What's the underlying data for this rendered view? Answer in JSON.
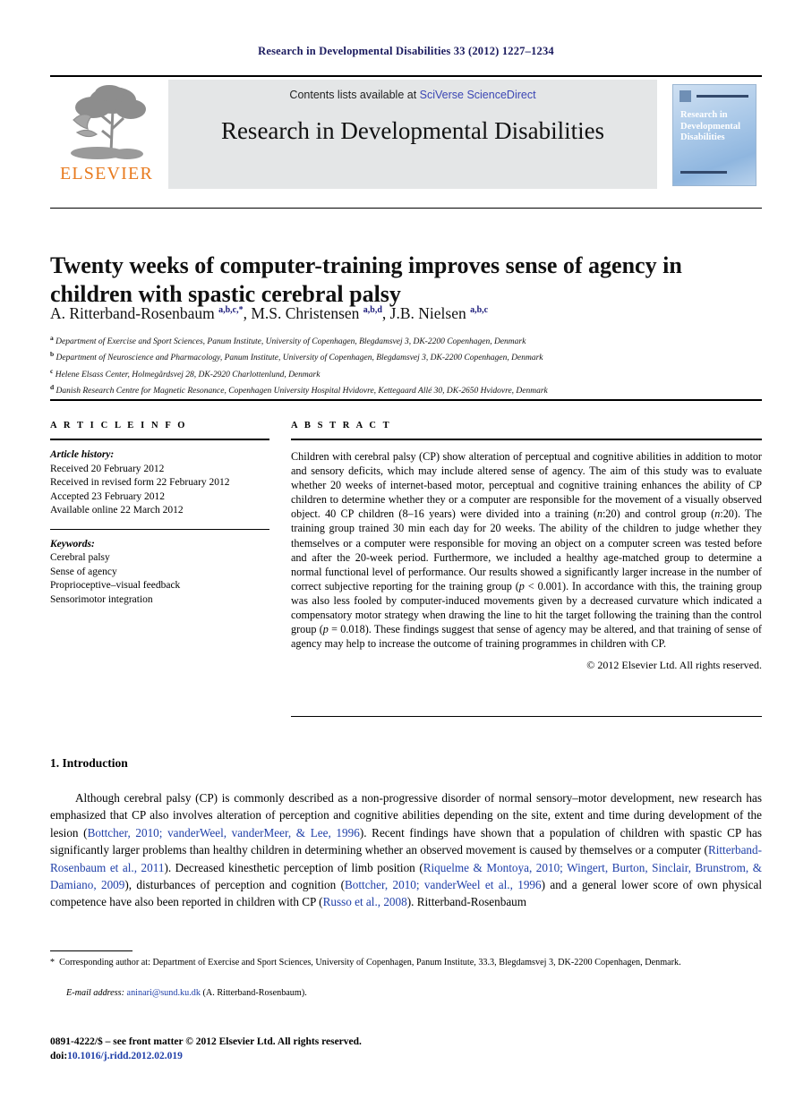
{
  "running_head": "Research in Developmental Disabilities 33 (2012) 1227–1234",
  "masthead": {
    "contents_prefix": "Contents lists available at ",
    "contents_link": "SciVerse ScienceDirect",
    "journal_title": "Research in Developmental Disabilities",
    "publisher_name": "ELSEVIER",
    "cover_text": "Research in Developmental Disabilities",
    "link_color": "#3b46b4",
    "band_color": "#e4e6e7",
    "publisher_color": "#e87a1e"
  },
  "article": {
    "title": "Twenty weeks of computer-training improves sense of agency in children with spastic cerebral palsy",
    "authors_html": "A. Ritterband-Rosenbaum <sup>a,b,c,*</sup>, M.S. Christensen <sup>a,b,d</sup>, J.B. Nielsen <sup>a,b,c</sup>",
    "affiliations": [
      {
        "marker": "a",
        "text": "Department of Exercise and Sport Sciences, Panum Institute, University of Copenhagen, Blegdamsvej 3, DK-2200 Copenhagen, Denmark"
      },
      {
        "marker": "b",
        "text": "Department of Neuroscience and Pharmacology, Panum Institute, University of Copenhagen, Blegdamsvej 3, DK-2200 Copenhagen, Denmark"
      },
      {
        "marker": "c",
        "text": "Helene Elsass Center, Holmegårdsvej 28, DK-2920 Charlottenlund, Denmark"
      },
      {
        "marker": "d",
        "text": "Danish Research Centre for Magnetic Resonance, Copenhagen University Hospital Hvidovre, Kettegaard Allé 30, DK-2650 Hvidovre, Denmark"
      }
    ]
  },
  "info": {
    "heading": "A R T I C L E   I N F O",
    "history_label": "Article history:",
    "history": [
      "Received 20 February 2012",
      "Received in revised form 22 February 2012",
      "Accepted 23 February 2012",
      "Available online 22 March 2012"
    ],
    "keywords_label": "Keywords:",
    "keywords": [
      "Cerebral palsy",
      "Sense of agency",
      "Proprioceptive–visual feedback",
      "Sensorimotor integration"
    ]
  },
  "abstract": {
    "heading": "A B S T R A C T",
    "text_html": "Children with cerebral palsy (CP) show alteration of perceptual and cognitive abilities in addition to motor and sensory deficits, which may include altered sense of agency. The aim of this study was to evaluate whether 20 weeks of internet-based motor, perceptual and cognitive training enhances the ability of CP children to determine whether they or a computer are responsible for the movement of a visually observed object. 40 CP children (8–16 years) were divided into a training (<i>n</i>:20) and control group (<i>n</i>:20). The training group trained 30 min each day for 20 weeks. The ability of the children to judge whether they themselves or a computer were responsible for moving an object on a computer screen was tested before and after the 20-week period. Furthermore, we included a healthy age-matched group to determine a normal functional level of performance. Our results showed a significantly larger increase in the number of correct subjective reporting for the training group (<i>p</i> &lt; 0.001). In accordance with this, the training group was also less fooled by computer-induced movements given by a decreased curvature which indicated a compensatory motor strategy when drawing the line to hit the target following the training than the control group (<i>p</i> = 0.018). These findings suggest that sense of agency may be altered, and that training of sense of agency may help to increase the outcome of training programmes in children with CP.",
    "copyright": "© 2012 Elsevier Ltd. All rights reserved."
  },
  "body": {
    "section_number_title": "1.  Introduction",
    "paragraph_html": "Although cerebral palsy (CP) is commonly described as a non-progressive disorder of normal sensory–motor development, new research has emphasized that CP also involves alteration of perception and cognitive abilities depending on the site, extent and time during development of the lesion (<span class=\"cite\">Bottcher, 2010; vanderWeel, vanderMeer, &amp; Lee, 1996</span>). Recent findings have shown that a population of children with spastic CP has significantly larger problems than healthy children in determining whether an observed movement is caused by themselves or a computer (<span class=\"cite\">Ritterband-Rosenbaum et al., 2011</span>). Decreased kinesthetic perception of limb position (<span class=\"cite\">Riquelme &amp; Montoya, 2010; Wingert, Burton, Sinclair, Brunstrom, &amp; Damiano, 2009</span>), disturbances of perception and cognition (<span class=\"cite\">Bottcher, 2010; vanderWeel et al., 1996</span>) and a general lower score of own physical competence have also been reported in children with CP (<span class=\"cite\">Russo et al., 2008</span>). Ritterband-Rosenbaum"
  },
  "footnotes": {
    "corresponding_html": "<span class=\"star\">*</span>&nbsp; Corresponding author at: Department of Exercise and Sport Sciences, University of Copenhagen, Panum Institute, 33.3, Blegdamsvej 3, DK-2200 Copenhagen, Denmark.",
    "email_label": "E-mail address:",
    "email": "aninari@sund.ku.dk",
    "email_suffix": "(A. Ritterband-Rosenbaum).",
    "imprint": "0891-4222/$ – see front matter © 2012 Elsevier Ltd. All rights reserved.",
    "doi_label": "doi:",
    "doi": "10.1016/j.ridd.2012.02.019"
  }
}
